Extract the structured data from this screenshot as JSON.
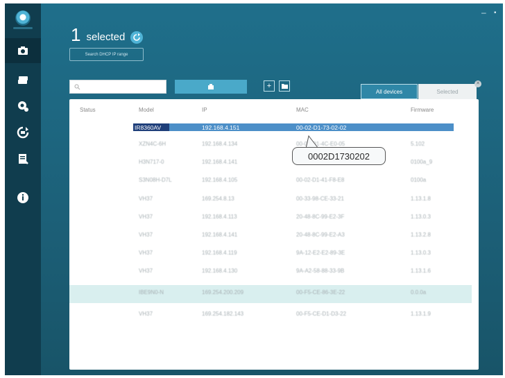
{
  "header": {
    "count": "1",
    "label": "selected",
    "search_ip_button": "Search DHCP IP range"
  },
  "tabs": [
    {
      "label": "All devices"
    },
    {
      "label": "Selected"
    }
  ],
  "table": {
    "columns": [
      "Status",
      "Model",
      "IP",
      "MAC",
      "Firmware"
    ],
    "selected_row": {
      "model": "IR8360AV",
      "ip": "192.168.4.151",
      "mac": "00-02-D1-73-02-02"
    },
    "rows": [
      {
        "model": "XZN4C-6H",
        "ip": "192.168.4.134",
        "mac": "00-02-D1-4C-E0-05",
        "firmware": "5.102"
      },
      {
        "model": "H3N717-0",
        "ip": "192.168.4.141",
        "mac": "00-02-D1-5C-F4-1A",
        "firmware": "0100a_9"
      },
      {
        "model": "S3N08H-D7L",
        "ip": "192.168.4.105",
        "mac": "00-02-D1-41-F8-E8",
        "firmware": "0100a"
      },
      {
        "model": "VH37",
        "ip": "169.254.8.13",
        "mac": "00-33-98-CE-33-21",
        "firmware": "1.13.1.8"
      },
      {
        "model": "VH37",
        "ip": "192.168.4.113",
        "mac": "20-48-8C-99-E2-3F",
        "firmware": "1.13.0.3"
      },
      {
        "model": "VH37",
        "ip": "192.168.4.141",
        "mac": "20-48-8C-99-E2-A3",
        "firmware": "1.13.2.8"
      },
      {
        "model": "VH37",
        "ip": "192.168.4.119",
        "mac": "9A-12-E2-E2-89-3E",
        "firmware": "1.13.0.3"
      },
      {
        "model": "VH37",
        "ip": "192.168.4.130",
        "mac": "9A-A2-58-88-33-9B",
        "firmware": "1.13.1.6"
      },
      {
        "model": "IBE9N0-N",
        "ip": "169.254.200.209",
        "mac": "00-F5-CE-86-3E-22",
        "firmware": "0.0.0a"
      },
      {
        "model": "VH37",
        "ip": "169.254.182.143",
        "mac": "00-F5-CE-D1-D3-22",
        "firmware": "1.13.1.9"
      }
    ]
  },
  "tooltip": {
    "text": "0002D1730202"
  },
  "icons": [
    "camera-icon",
    "recorder-icon",
    "settings-icon",
    "sync-icon",
    "report-icon",
    "info-icon"
  ]
}
